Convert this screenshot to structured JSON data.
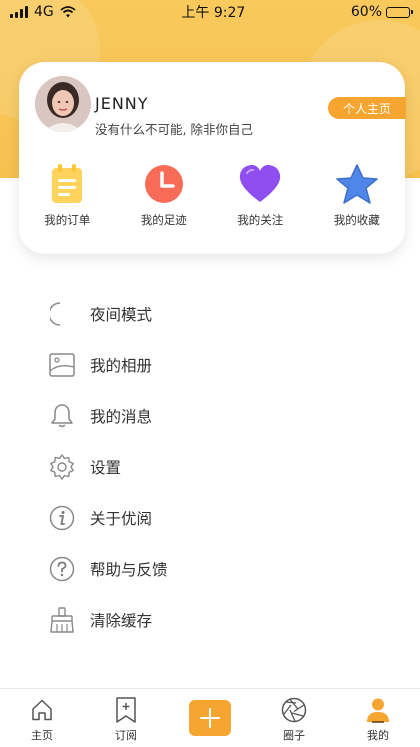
{
  "status_bar": {
    "carrier": "4G",
    "time": "上午 9:27",
    "battery": "60%",
    "battery_level": 0.6
  },
  "profile": {
    "username": "JENNY",
    "signature": "没有什么不可能, 除非你自己",
    "homepage_label": "个人主页"
  },
  "quick_actions": [
    {
      "label": "我的订单",
      "icon": "order-icon",
      "color": "#ffd35c"
    },
    {
      "label": "我的足迹",
      "icon": "clock-icon",
      "color": "#f76b57"
    },
    {
      "label": "我的关注",
      "icon": "heart-icon",
      "color": "#8e4ef0"
    },
    {
      "label": "我的收藏",
      "icon": "star-icon",
      "color": "#4f86e8"
    }
  ],
  "menu": [
    {
      "label": "夜间模式",
      "icon": "moon-icon"
    },
    {
      "label": "我的相册",
      "icon": "photo-album-icon"
    },
    {
      "label": "我的消息",
      "icon": "bell-icon"
    },
    {
      "label": "设置",
      "icon": "gear-icon"
    },
    {
      "label": "关于优阅",
      "icon": "info-icon"
    },
    {
      "label": "帮助与反馈",
      "icon": "help-icon"
    },
    {
      "label": "清除缓存",
      "icon": "broom-icon"
    }
  ],
  "tabs": [
    {
      "label": "主页",
      "icon": "home-icon"
    },
    {
      "label": "订阅",
      "icon": "bookmark-icon"
    },
    {
      "label": "",
      "icon": "add-icon"
    },
    {
      "label": "圈子",
      "icon": "aperture-icon"
    },
    {
      "label": "我的",
      "icon": "user-icon",
      "active": true
    }
  ],
  "colors": {
    "accent": "#f6a530",
    "header": "#f8c554"
  }
}
